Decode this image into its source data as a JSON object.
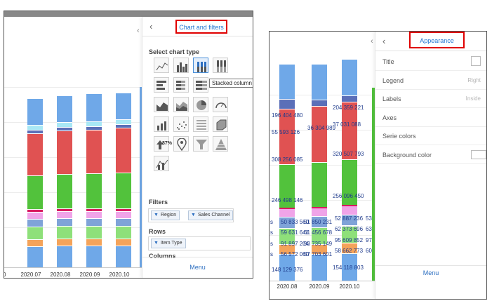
{
  "colors": {
    "accent": "#1e74d2",
    "highlight_box": "#e00000",
    "segments": [
      "#6fa8e8",
      "#f4a35a",
      "#8ee07a",
      "#7fa3d8",
      "#f0a4e8",
      "#d81b60",
      "#52c23c",
      "#e05252",
      "#5b6fb8",
      "#a9e8f5",
      "#6fa8e8"
    ]
  },
  "left": {
    "panel_title": "Chart and filters",
    "back_icon": "chevron-left-icon",
    "select_chart_type_label": "Select chart type",
    "chart_type_icons": [
      "line-chart-icon",
      "column-chart-icon",
      "stacked-column-icon",
      "percent-column-icon",
      "bar-chart-icon",
      "stacked-bar-icon",
      "percent-bar-icon",
      "area-chart-icon",
      "stacked-area-icon",
      "pie-chart-icon",
      "gauge-icon",
      "combo-chart-icon",
      "scatter-icon",
      "table-icon",
      "shape-icon",
      "kpi-icon",
      "map-pin-icon",
      "funnel-icon",
      "pyramid-icon",
      "line-bar-combo-icon"
    ],
    "kpi_text": "87%",
    "tooltip": "Stacked column",
    "filters_label": "Filters",
    "filters": [
      "Region",
      "Sales Channel"
    ],
    "rows_label": "Rows",
    "rows": [
      "Item Type"
    ],
    "columns_label": "Columns",
    "menu_label": "Menu",
    "x_labels": [
      "20",
      "2020.07",
      "2020.08",
      "2020.09",
      "2020.10",
      "20"
    ]
  },
  "right": {
    "panel_title": "Appearance",
    "back_icon": "chevron-left-icon",
    "properties": [
      {
        "label": "Title",
        "value": "",
        "control": "checkbox"
      },
      {
        "label": "Legend",
        "value": "Right",
        "control": "text"
      },
      {
        "label": "Labels",
        "value": "Inside",
        "control": "text"
      },
      {
        "label": "Axes",
        "value": "",
        "control": "none"
      },
      {
        "label": "Serie colors",
        "value": "",
        "control": "none"
      },
      {
        "label": "Background color",
        "value": "",
        "control": "color"
      }
    ],
    "menu_label": "Menu",
    "x_labels": [
      "2020.08",
      "2020.09",
      "2020.10"
    ],
    "data_labels": {
      "col1": [
        "196 404 480",
        "55 593 126",
        "308 256 085",
        "246 498 146",
        "50 833 560",
        "59 631 641",
        "91 897 204",
        "56 572 060",
        "148 129 376"
      ],
      "col2": [
        "36 304 989",
        "51 850 231",
        "61 456 678",
        "93 735 149",
        "57 703 601"
      ],
      "col3": [
        "204 359 221",
        "37 031 088",
        "320 507 793",
        "256 096 450",
        "52 887 236",
        "62 373 696",
        "95 609 852",
        "58 662 773",
        "154 118 803"
      ],
      "col4": [
        "53",
        "63",
        "97",
        "60"
      ],
      "leading": [
        "s",
        "s",
        "s",
        "s"
      ]
    }
  },
  "chart_data": [
    {
      "type": "bar",
      "stacked": true,
      "categories": [
        "2020.07",
        "2020.08",
        "2020.09",
        "2020.10"
      ],
      "series": [
        {
          "values": [
            30,
            31,
            31,
            31
          ]
        },
        {
          "values": [
            10,
            10,
            10,
            10
          ]
        },
        {
          "values": [
            18,
            18,
            18,
            18
          ]
        },
        {
          "values": [
            11,
            11,
            11,
            11
          ]
        },
        {
          "values": [
            10,
            10,
            10,
            10
          ]
        },
        {
          "values": [
            4,
            4,
            4,
            4
          ]
        },
        {
          "values": [
            48,
            49,
            50,
            51
          ]
        },
        {
          "values": [
            60,
            62,
            62,
            64
          ]
        },
        {
          "values": [
            5,
            5,
            5,
            5
          ]
        },
        {
          "values": [
            7,
            7,
            7,
            7
          ]
        },
        {
          "values": [
            38,
            38,
            40,
            38
          ]
        }
      ]
    },
    {
      "type": "bar",
      "stacked": true,
      "categories": [
        "2020.08",
        "2020.09",
        "2020.10"
      ],
      "series": [
        {
          "values": [
            148129376,
            148129376,
            154118803
          ]
        },
        {
          "values": [
            56572060,
            57703601,
            58662773
          ]
        },
        {
          "values": [
            91897204,
            93735149,
            95609852
          ]
        },
        {
          "values": [
            59631641,
            61456678,
            62373696
          ]
        },
        {
          "values": [
            50833560,
            51850231,
            52887236
          ]
        },
        {
          "values": [
            246498146,
            251300000,
            256096450
          ]
        },
        {
          "values": [
            308256085,
            314200000,
            320507793
          ]
        },
        {
          "values": [
            55593126,
            36304989,
            37031088
          ]
        },
        {
          "values": [
            196404480,
            200300000,
            204359221
          ]
        }
      ]
    }
  ]
}
